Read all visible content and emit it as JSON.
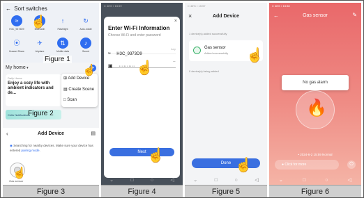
{
  "p1": {
    "sort_title": "Sort switches",
    "toggles": [
      {
        "label": "H3C_9373D9",
        "icon": "wifi-icon",
        "on": true
      },
      {
        "label": "Bluetooth",
        "icon": "bluetooth-icon",
        "on": true
      },
      {
        "label": "Flashlight",
        "icon": "flashlight-icon",
        "on": false
      },
      {
        "label": "Auto-rotate",
        "icon": "rotate-icon",
        "on": false
      },
      {
        "label": "Huawei Share",
        "icon": "share-icon",
        "on": false
      },
      {
        "label": "Airplane",
        "icon": "airplane-icon",
        "on": false
      },
      {
        "label": "Mobile data",
        "icon": "data-icon",
        "on": true
      },
      {
        "label": "Sound",
        "icon": "bell-icon",
        "on": true
      }
    ],
    "home_label": "My home",
    "card_tag": "Daily Home",
    "card_text": "Enjoy a cozy life with ambient indicators and de...",
    "menu": [
      "Add Device",
      "Create Scene",
      "Scan"
    ],
    "figure1": "Figure 1",
    "figure2": "Figure 2",
    "banner": "Cello Notifications"
  },
  "p3": {
    "title": "Add Device",
    "message": "Searching for nearby devices. Make sure your device has entered",
    "link": "pairing mode",
    "device_label": "Gas sensor"
  },
  "p4": {
    "title": "Enter Wi-Fi Information",
    "subtitle": "Choose Wi-Fi and enter password",
    "ssid": "H3C_9373D9",
    "ssid_hint": "Any",
    "password": "··········",
    "next": "Next"
  },
  "p5": {
    "title": "Add Device",
    "added_count": "1 device(s) added successfully",
    "device_name": "Gas sensor",
    "device_status": "Added successfully",
    "being_added": "0 device(s) being added",
    "done": "Done"
  },
  "p6": {
    "title": "Gas sensor",
    "status": "No gas alarm",
    "timestamp": "2024-6-2 15:59 Normal",
    "more": "Click for more"
  },
  "captions": [
    "Figure 3",
    "Figure 4",
    "Figure 5",
    "Figure 6"
  ],
  "colors": {
    "accent_blue": "#2f6df0",
    "teal": "#23b5a8",
    "gas_red": "#e9686a",
    "next_blue": "#3a6fe0"
  }
}
